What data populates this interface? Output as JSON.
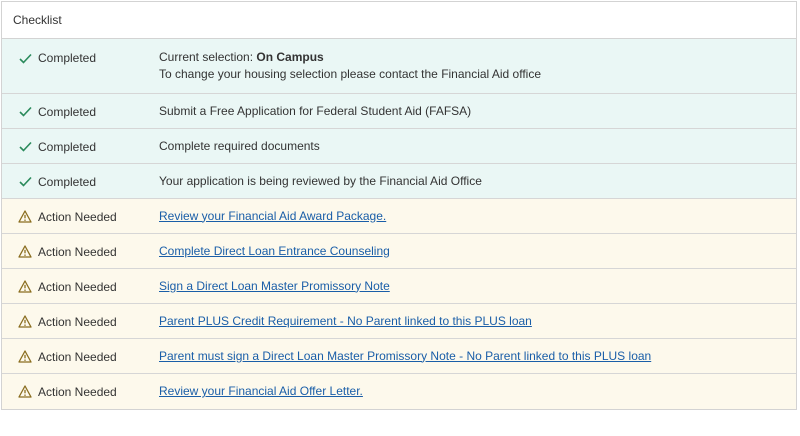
{
  "header": {
    "title": "Checklist"
  },
  "rows": [
    {
      "status": "Completed",
      "line1_prefix": "Current selection: ",
      "line1_bold": "On Campus",
      "line2": "To change your housing selection please contact the Financial Aid office"
    },
    {
      "status": "Completed",
      "text": "Submit a Free Application for Federal Student Aid (FAFSA)"
    },
    {
      "status": "Completed",
      "text": "Complete required documents"
    },
    {
      "status": "Completed",
      "text": "Your application is being reviewed by the Financial Aid Office"
    },
    {
      "status": "Action Needed",
      "link": "Review your Financial Aid Award Package."
    },
    {
      "status": "Action Needed",
      "link": "Complete Direct Loan Entrance Counseling"
    },
    {
      "status": "Action Needed",
      "link": "Sign a Direct Loan Master Promissory Note"
    },
    {
      "status": "Action Needed",
      "link": "Parent PLUS Credit Requirement - No Parent linked to this PLUS loan"
    },
    {
      "status": "Action Needed",
      "link": "Parent must sign a Direct Loan Master Promissory Note - No Parent linked to this PLUS loan"
    },
    {
      "status": "Action Needed",
      "link": "Review your Financial Aid Offer Letter."
    }
  ],
  "colors": {
    "completed_bg": "#eaf7f5",
    "action_bg": "#fdf9ec",
    "check": "#2a8a5b",
    "warning": "#8a6d1f",
    "link": "#1a5ea8"
  }
}
